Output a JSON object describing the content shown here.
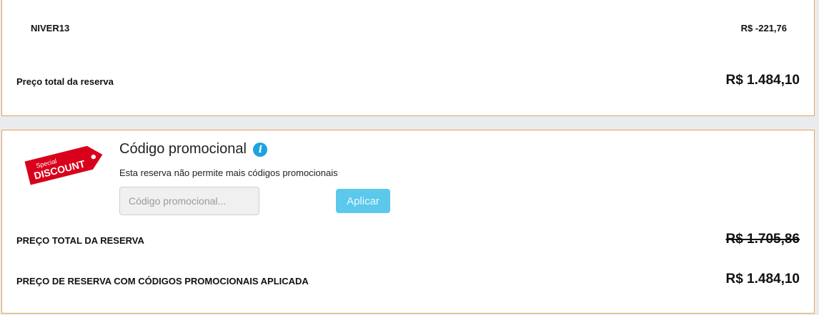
{
  "summary": {
    "coupon_code": "NIVER13",
    "coupon_amount": "R$ -221,76",
    "total_label": "Preço total da reserva",
    "total_value": "R$ 1.484,10"
  },
  "promo": {
    "badge_line1": "Special",
    "badge_line2": "DISCOUNT",
    "title": "Código promocional",
    "info_glyph": "i",
    "note": "Esta reserva não permite mais códigos promocionais",
    "input_placeholder": "Código promocional...",
    "input_value": "",
    "apply_label": "Aplicar",
    "badge_color": "#d9001b",
    "info_color": "#1da3e0",
    "apply_color": "#5bc8ec"
  },
  "totals": {
    "original_label": "PREÇO TOTAL DA RESERVA",
    "original_value": "R$ 1.705,86",
    "final_label": "PREÇO DE RESERVA COM CÓDIGOS PROMOCIONAIS APLICADA",
    "final_value": "R$ 1.484,10"
  },
  "theme": {
    "panel_border": "#e8a25a",
    "background": "#e9ecef"
  }
}
